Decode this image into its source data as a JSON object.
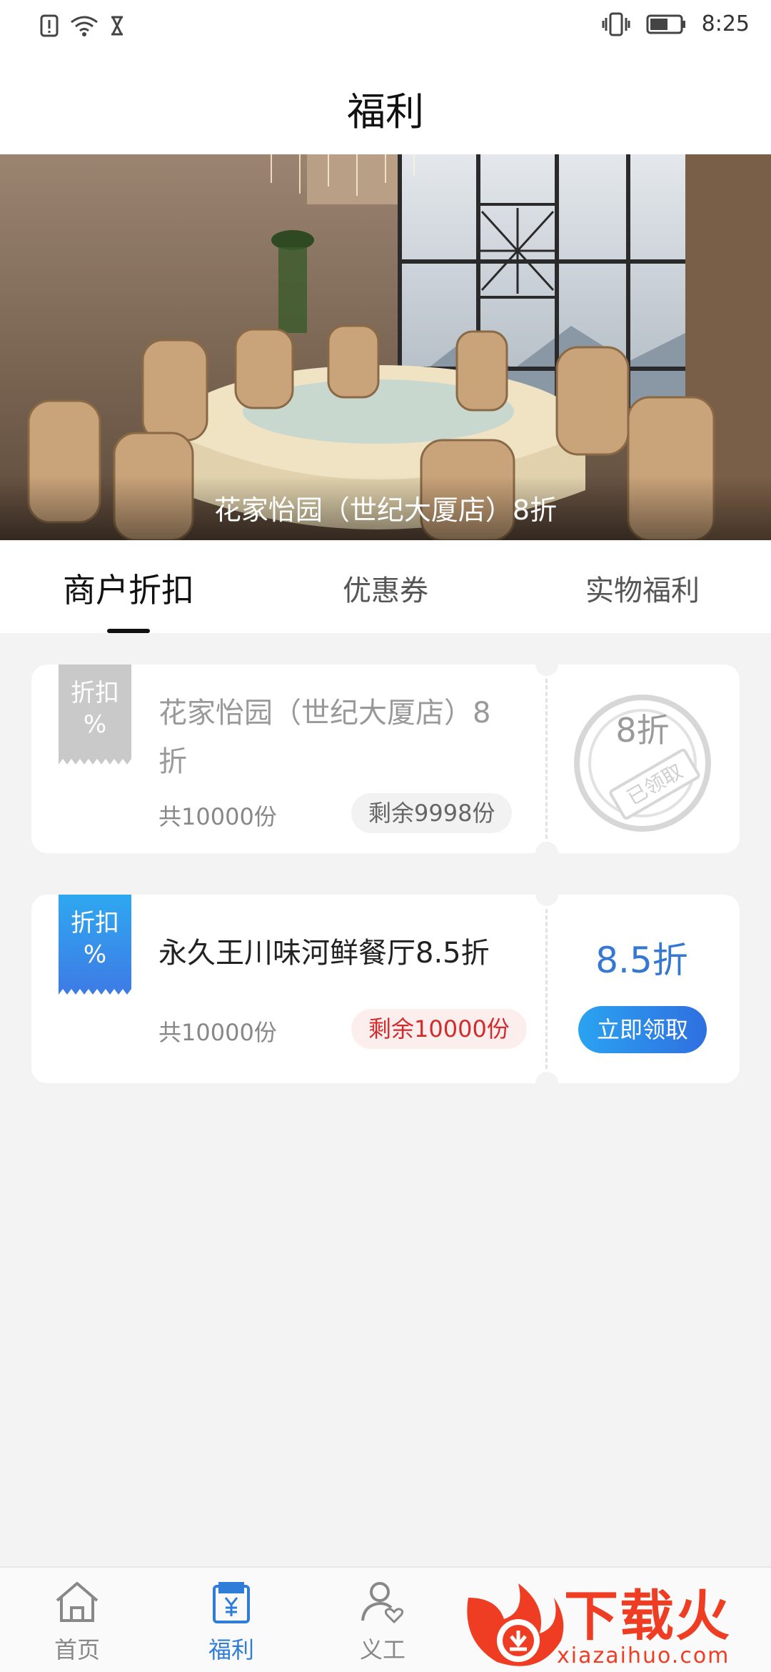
{
  "status_bar": {
    "time": "8:25",
    "icons": [
      "alert-icon",
      "wifi-icon",
      "hourglass-icon",
      "vibrate-icon",
      "battery-icon"
    ]
  },
  "header": {
    "title": "福利"
  },
  "banner": {
    "caption": "花家怡园（世纪大厦店）8折"
  },
  "tabs": [
    {
      "label": "商户折扣",
      "active": true
    },
    {
      "label": "优惠券",
      "active": false
    },
    {
      "label": "实物福利",
      "active": false
    }
  ],
  "cards": [
    {
      "ribbon": "折扣",
      "ribbon_symbol": "%",
      "title_line1": "花家怡园（世纪大厦店）8",
      "title_line2": "折",
      "total": "共10000份",
      "remaining": "剩余9998份",
      "discount": "8折",
      "stamp_text": "已领取",
      "claimed": true
    },
    {
      "ribbon": "折扣",
      "ribbon_symbol": "%",
      "title_line1": "永久王川味河鲜餐厅8.5折",
      "total": "共10000份",
      "remaining": "剩余10000份",
      "discount": "8.5折",
      "button": "立即领取",
      "claimed": false
    }
  ],
  "bottom_nav": [
    {
      "label": "首页",
      "icon": "home-icon",
      "active": false
    },
    {
      "label": "福利",
      "icon": "welfare-icon",
      "active": true
    },
    {
      "label": "义工",
      "icon": "volunteer-icon",
      "active": false
    }
  ],
  "watermark": {
    "brand": "下载火",
    "domain": "xiazaihuo.com"
  },
  "colors": {
    "accent": "#2f7dd8",
    "red": "#d22b2b",
    "background": "#f3f3f3"
  }
}
